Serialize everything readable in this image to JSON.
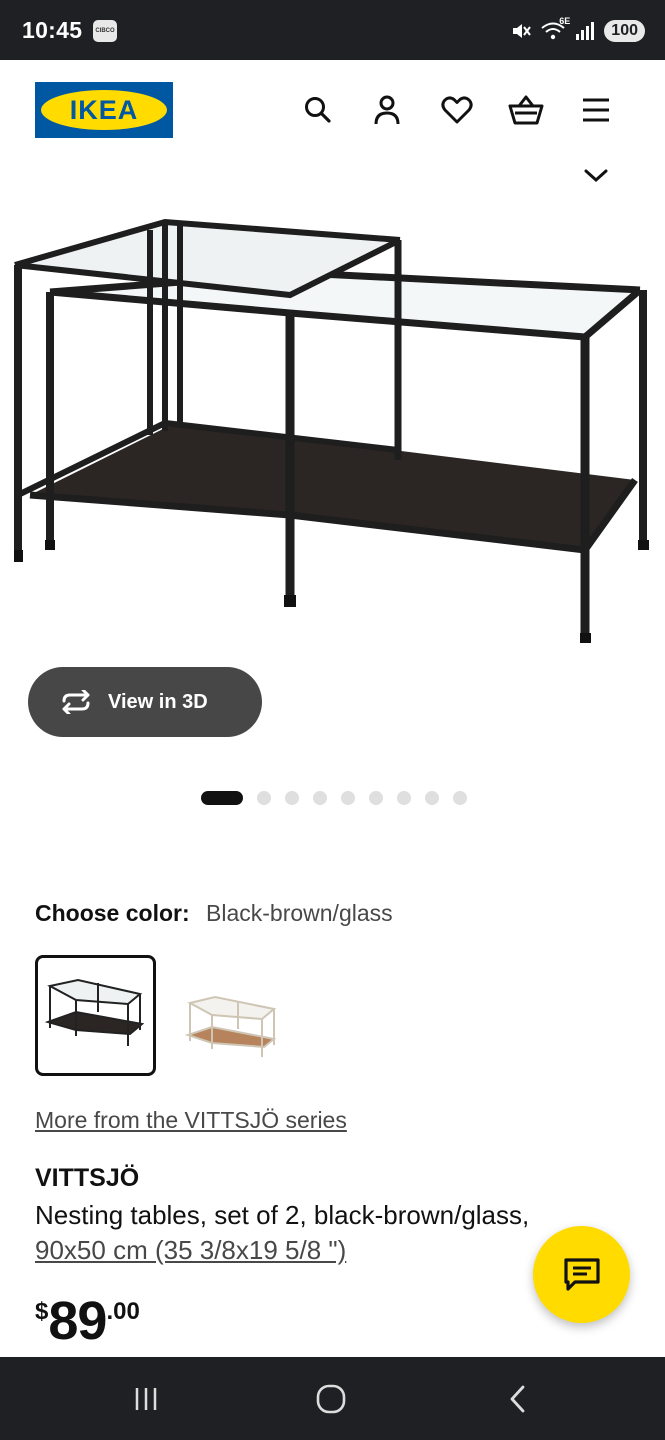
{
  "status_bar": {
    "time": "10:45",
    "app_badge": "CIBCO",
    "network": "6E",
    "battery": "100"
  },
  "header": {
    "logo_text": "IKEA",
    "icons": [
      "search-icon",
      "account-icon",
      "heart-icon",
      "basket-icon",
      "menu-icon"
    ]
  },
  "gallery": {
    "view3d_label": "View in 3D",
    "image_count": 9,
    "active_index": 0
  },
  "color": {
    "label": "Choose color:",
    "value": "Black-brown/glass",
    "options": [
      "Black-brown/glass",
      "White/glass"
    ]
  },
  "product": {
    "series_link": "More from the VITTSJÖ series",
    "name": "VITTSJÖ",
    "description": "Nesting tables, set of 2, black-brown/glass,",
    "size": "90x50 cm (35 3/8x19 5/8 \")",
    "price_currency": "$",
    "price_int": "89",
    "price_dec": ".00"
  },
  "colors": {
    "brand_blue": "#0058a3",
    "brand_yellow": "#ffdb00",
    "button_dark": "#474747"
  }
}
